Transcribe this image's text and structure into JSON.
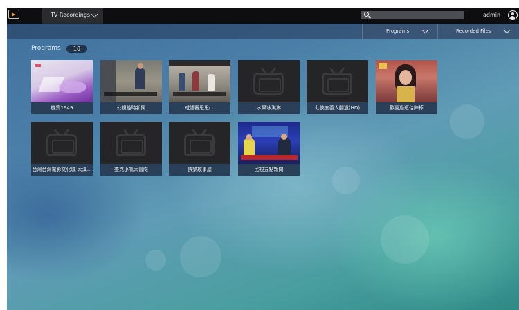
{
  "topbar": {
    "section": "TV Recordings",
    "search_placeholder": "",
    "user": "admin"
  },
  "subbar": {
    "view_filter": "Programs",
    "recording_filter": "Recorded Files"
  },
  "main": {
    "heading": "Programs",
    "count": "10",
    "programs": [
      {
        "title": "機寶1949",
        "thumbnail": "purple-product-scene"
      },
      {
        "title": "公視晚時新聞",
        "thumbnail": "street-news-scene"
      },
      {
        "title": "成語審思思cc",
        "thumbnail": "crowd-scene"
      },
      {
        "title": "水果冰淇淋",
        "thumbnail": "tv-placeholder-icon"
      },
      {
        "title": "七俠五義人間道(HD)",
        "thumbnail": "tv-placeholder-icon"
      },
      {
        "title": "歡喜過逗佮陣掉",
        "thumbnail": "drama-portrait-scene"
      },
      {
        "title": "台灣台灣電影文化城 大漢...",
        "thumbnail": "tv-placeholder-icon"
      },
      {
        "title": "查克小呱大冒險",
        "thumbnail": "tv-placeholder-icon"
      },
      {
        "title": "快樂故事屋",
        "thumbnail": "tv-placeholder-icon"
      },
      {
        "title": "民視五點新聞",
        "thumbnail": "news-anchors-scene"
      }
    ]
  }
}
